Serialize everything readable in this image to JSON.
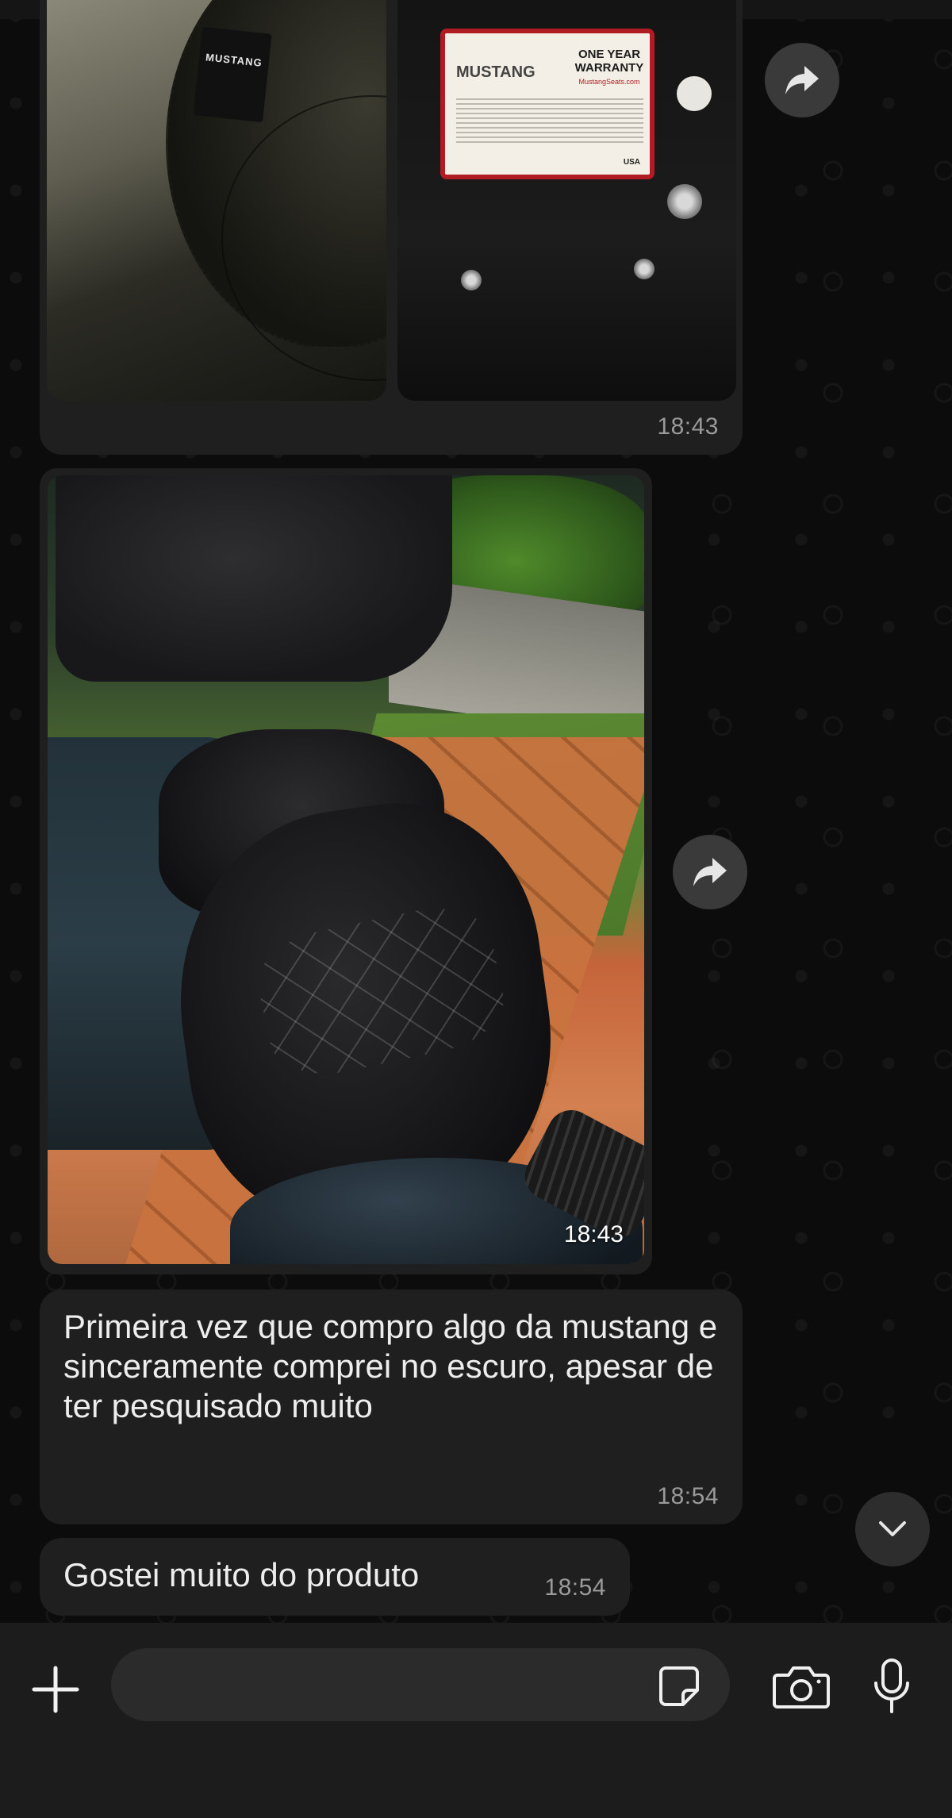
{
  "chat": {
    "album": {
      "time": "18:43",
      "patch_text": "MUSTANG",
      "warranty_card": {
        "brand": "MUSTANG",
        "title": "ONE YEAR WARRANTY",
        "url": "MustangSeats.com",
        "made_in": "USA"
      }
    },
    "photo": {
      "time": "18:43"
    },
    "messages": [
      {
        "text": "Primeira vez que compro algo da mustang e sinceramente comprei no escuro, apesar de ter pesquisado muito",
        "time": "18:54"
      },
      {
        "text": "Gostei muito do produto",
        "time": "18:54"
      }
    ]
  },
  "icons": {
    "forward": "forward-icon",
    "scroll_down": "chevron-down-icon",
    "attach": "plus-icon",
    "sticker": "sticker-icon",
    "camera": "camera-icon",
    "mic": "microphone-icon"
  },
  "composer": {
    "value": "",
    "placeholder": ""
  },
  "colors": {
    "bubble": "#1f1f1f",
    "background": "#0c0c0c",
    "composer": "#1c1c1c",
    "timestamp": "#9a9a9a"
  }
}
